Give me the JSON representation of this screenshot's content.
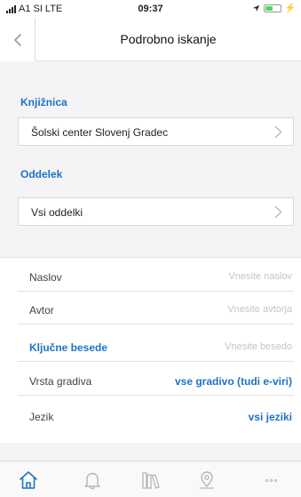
{
  "status_bar": {
    "carrier": "A1 SI",
    "network": "LTE",
    "time": "09:37",
    "battery_level": 0.55
  },
  "nav": {
    "title": "Podrobno iskanje"
  },
  "library": {
    "label": "Knjižnica",
    "value": "Šolski center Slovenj Gradec"
  },
  "department": {
    "label": "Oddelek",
    "value": "Vsi oddelki"
  },
  "form": {
    "title_label": "Naslov",
    "title_placeholder": "Vnesite naslov",
    "author_label": "Avtor",
    "author_placeholder": "Vnesite avtorja",
    "keywords_label": "Ključne besede",
    "keywords_placeholder": "Vnesite besedo",
    "material_label": "Vrsta gradiva",
    "material_value": "vse gradivo (tudi e-viri)",
    "language_label": "Jezik",
    "language_value": "vsi jeziki"
  },
  "tabs": [
    {
      "icon": "home-icon",
      "active": true
    },
    {
      "icon": "bell-icon",
      "active": false
    },
    {
      "icon": "books-icon",
      "active": false
    },
    {
      "icon": "location-pin-icon",
      "active": false
    },
    {
      "icon": "more-icon",
      "active": false
    }
  ],
  "colors": {
    "accent": "#1e72c8",
    "background": "#f4f4f6",
    "placeholder": "#c4c4c4",
    "battery": "#4cd964"
  }
}
